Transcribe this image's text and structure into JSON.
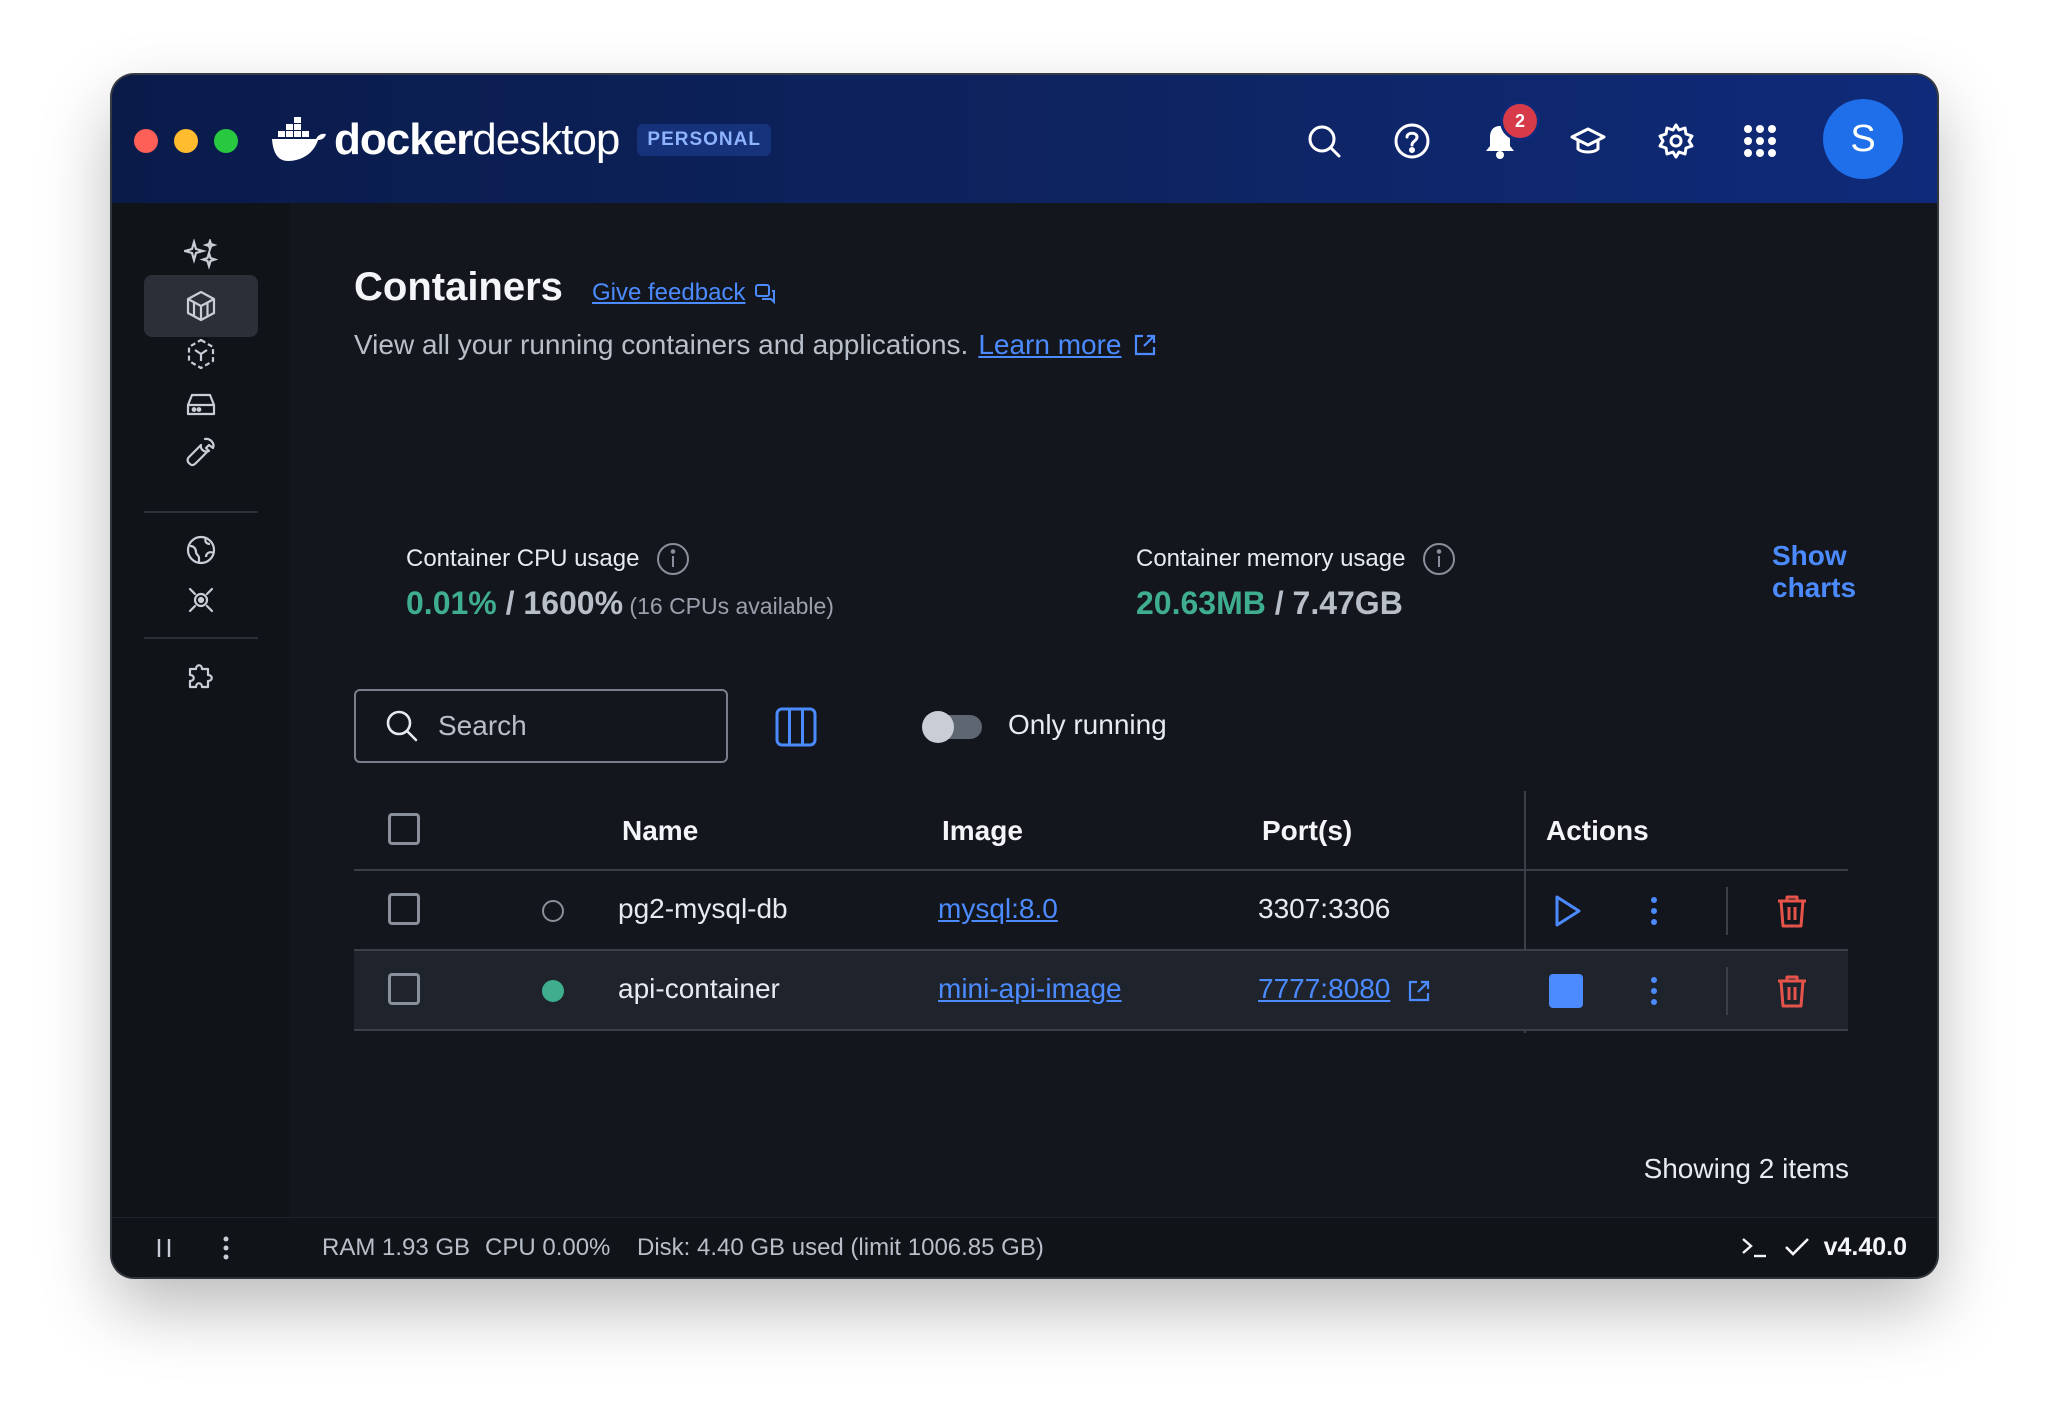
{
  "app": {
    "brand_bold": "docker",
    "brand_light": "desktop",
    "plan_badge": "PERSONAL",
    "notification_count": "2",
    "avatar_initial": "S"
  },
  "icons": {
    "titlebar": [
      "search-icon",
      "help-icon",
      "bell-icon",
      "learning-center-icon",
      "settings-icon",
      "app-grid-icon"
    ],
    "sidebar": [
      "ask-gordon-icon",
      "containers-icon",
      "images-icon",
      "volumes-icon",
      "builds-icon",
      "docker-hub-icon",
      "docker-scout-icon",
      "extensions-icon"
    ]
  },
  "page": {
    "title": "Containers",
    "feedback_link": "Give feedback",
    "subtitle": "View all your running containers and applications.",
    "learn_more": "Learn more"
  },
  "stats": {
    "cpu_label": "Container CPU usage",
    "cpu_used": "0.01%",
    "cpu_total": " / 1600%",
    "cpu_note": " (16 CPUs available)",
    "mem_label": "Container memory usage",
    "mem_used": "20.63MB",
    "mem_total": " / 7.47GB",
    "show_charts": "Show charts"
  },
  "toolbar": {
    "search_placeholder": "Search",
    "only_running_label": "Only running",
    "only_running_enabled": false
  },
  "table": {
    "headers": {
      "name": "Name",
      "image": "Image",
      "ports": "Port(s)",
      "actions": "Actions"
    },
    "rows": [
      {
        "status": "stopped",
        "name": "pg2-mysql-db",
        "image": "mysql:8.0",
        "ports": "3307:3306",
        "port_link": false
      },
      {
        "status": "running",
        "name": "api-container",
        "image": "mini-api-image",
        "ports": "7777:8080",
        "port_link": true
      }
    ],
    "footer": "Showing 2 items"
  },
  "statusbar": {
    "ram": "RAM 1.93 GB",
    "cpu": "CPU 0.00%",
    "disk": "Disk: 4.40 GB used (limit 1006.85 GB)",
    "version": "v4.40.0"
  },
  "colors": {
    "accent": "#4b8bff",
    "running_green": "#3fae8e",
    "danger": "#e5534b",
    "titlebar": "#0e2461",
    "background": "#13161c"
  }
}
